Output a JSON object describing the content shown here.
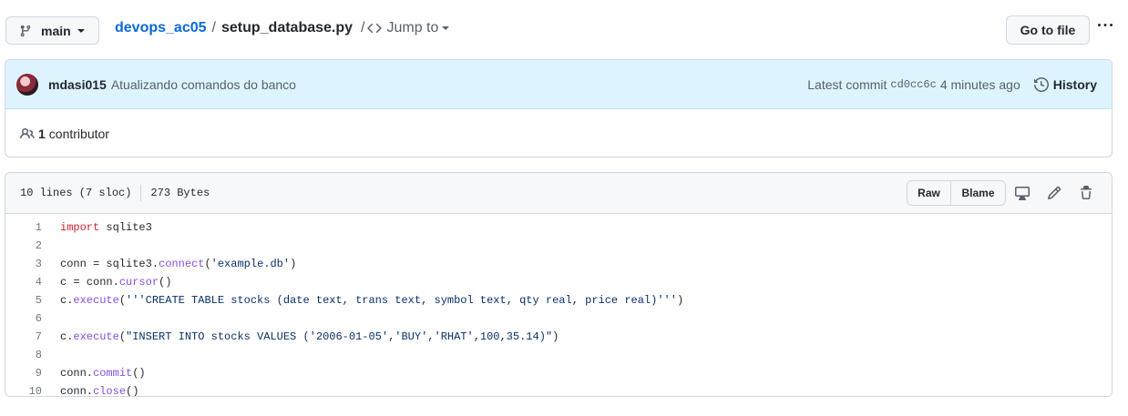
{
  "branch": {
    "label": "main"
  },
  "breadcrumb": {
    "repo": "devops_ac05",
    "separator": "/",
    "file": "setup_database.py",
    "separator2": "/",
    "jump_label": "Jump to"
  },
  "go_to_file": "Go to file",
  "commit": {
    "author": "mdasi015",
    "message": "Atualizando comandos do banco",
    "latest_label": "Latest commit",
    "sha": "cd0cc6c",
    "time": "4 minutes ago",
    "history_label": "History"
  },
  "contributors": {
    "count": "1",
    "label": "contributor"
  },
  "file": {
    "lines_info": "10 lines (7 sloc)",
    "size": "273 Bytes",
    "raw_label": "Raw",
    "blame_label": "Blame"
  },
  "code": [
    {
      "n": "1",
      "tokens": [
        {
          "t": "import",
          "c": "kw"
        },
        {
          "t": " sqlite3",
          "c": ""
        }
      ]
    },
    {
      "n": "2",
      "tokens": []
    },
    {
      "n": "3",
      "tokens": [
        {
          "t": "conn = sqlite3.",
          "c": ""
        },
        {
          "t": "connect",
          "c": "fn"
        },
        {
          "t": "(",
          "c": ""
        },
        {
          "t": "'example.db'",
          "c": "str"
        },
        {
          "t": ")",
          "c": ""
        }
      ]
    },
    {
      "n": "4",
      "tokens": [
        {
          "t": "c = conn.",
          "c": ""
        },
        {
          "t": "cursor",
          "c": "fn"
        },
        {
          "t": "()",
          "c": ""
        }
      ]
    },
    {
      "n": "5",
      "tokens": [
        {
          "t": "c.",
          "c": ""
        },
        {
          "t": "execute",
          "c": "fn"
        },
        {
          "t": "(",
          "c": ""
        },
        {
          "t": "'''CREATE TABLE stocks (date text, trans text, symbol text, qty real, price real)'''",
          "c": "str"
        },
        {
          "t": ")",
          "c": ""
        }
      ]
    },
    {
      "n": "6",
      "tokens": []
    },
    {
      "n": "7",
      "tokens": [
        {
          "t": "c.",
          "c": ""
        },
        {
          "t": "execute",
          "c": "fn"
        },
        {
          "t": "(",
          "c": ""
        },
        {
          "t": "\"INSERT INTO stocks VALUES ('2006-01-05','BUY','RHAT',100,35.14)\"",
          "c": "str"
        },
        {
          "t": ")",
          "c": ""
        }
      ]
    },
    {
      "n": "8",
      "tokens": []
    },
    {
      "n": "9",
      "tokens": [
        {
          "t": "conn.",
          "c": ""
        },
        {
          "t": "commit",
          "c": "fn"
        },
        {
          "t": "()",
          "c": ""
        }
      ]
    },
    {
      "n": "10",
      "tokens": [
        {
          "t": "conn.",
          "c": ""
        },
        {
          "t": "close",
          "c": "fn"
        },
        {
          "t": "()",
          "c": ""
        }
      ]
    }
  ],
  "colors": {
    "link": "#0969da",
    "keyword": "#cf222e",
    "function": "#8250df",
    "string": "#0a3069",
    "commit_bg": "#ddf4ff"
  },
  "icons": [
    "git-branch-icon",
    "code-icon",
    "kebab-horizontal-icon",
    "history-icon",
    "people-icon",
    "desktop-icon",
    "pencil-icon",
    "trash-icon"
  ]
}
